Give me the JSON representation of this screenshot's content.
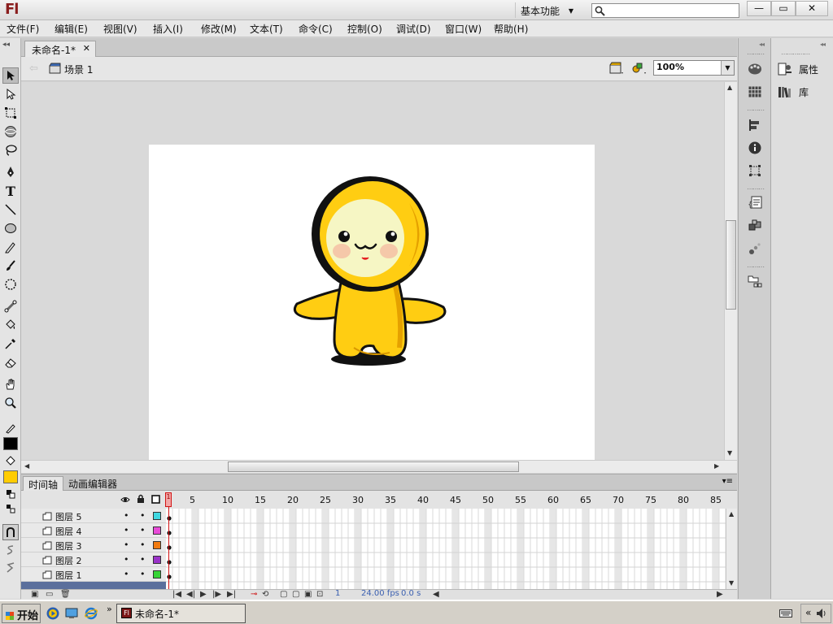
{
  "app": {
    "logo": "Fl",
    "workspace": "基本功能",
    "window_buttons": [
      "—",
      "▭",
      "✕"
    ]
  },
  "menu": [
    "文件(F)",
    "编辑(E)",
    "视图(V)",
    "插入(I)",
    "修改(M)",
    "文本(T)",
    "命令(C)",
    "控制(O)",
    "调试(D)",
    "窗口(W)",
    "帮助(H)"
  ],
  "document": {
    "tab_title": "未命名-1*",
    "scene": "场景 1",
    "zoom": "100%"
  },
  "colors": {
    "stroke": "#000000",
    "fill": "#ffcc00",
    "stage": "#ffffff"
  },
  "timeline": {
    "tabs": [
      "时间轴",
      "动画编辑器"
    ],
    "frame_numbers": [
      "1",
      "5",
      "10",
      "15",
      "20",
      "25",
      "30",
      "35",
      "40",
      "45",
      "50",
      "55",
      "60",
      "65",
      "70",
      "75",
      "80",
      "85"
    ],
    "layers": [
      {
        "name": "图层 5",
        "color": "#3fd7e0"
      },
      {
        "name": "图层 4",
        "color": "#e84ad8"
      },
      {
        "name": "图层 3",
        "color": "#f07a10"
      },
      {
        "name": "图层 2",
        "color": "#9a32c8"
      },
      {
        "name": "图层 1",
        "color": "#37d437"
      }
    ],
    "current_frame": "1",
    "fps": "24.00 fps",
    "time": "0.0 s"
  },
  "panels": {
    "properties": "属性",
    "library": "库"
  },
  "taskbar": {
    "start": "开始",
    "task_item": "未命名-1*"
  }
}
